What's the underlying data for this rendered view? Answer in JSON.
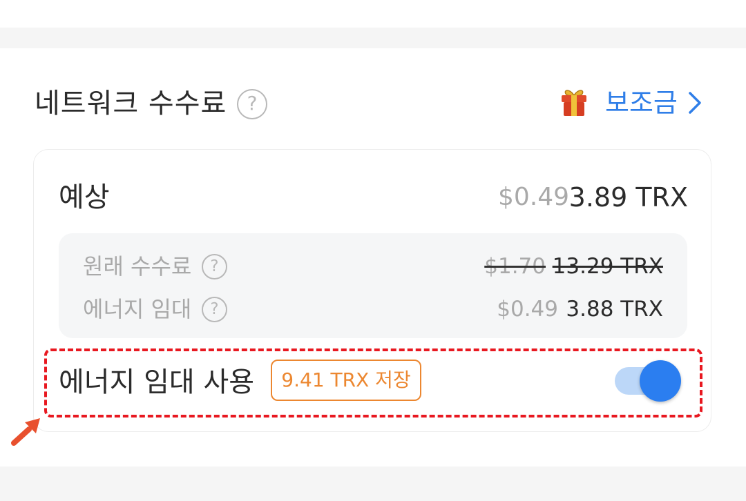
{
  "header": {
    "title": "네트워크 수수료",
    "help_glyph": "?",
    "subsidy_label": "보조금",
    "icons": [
      "help-icon",
      "gift-icon",
      "chevron-right-icon"
    ]
  },
  "estimate": {
    "label": "예상",
    "usd": "$0.49",
    "trx": "3.89 TRX"
  },
  "details": {
    "original_fee": {
      "label": "원래 수수료",
      "usd": "$1.70",
      "trx": "13.29 TRX",
      "strikethrough": true
    },
    "energy_rental": {
      "label": "에너지 임대",
      "usd": "$0.49",
      "trx": "3.88 TRX"
    }
  },
  "energy_toggle": {
    "label": "에너지 임대 사용",
    "badge": "9.41 TRX 저장",
    "enabled": true
  },
  "colors": {
    "accent": "#2f7ee8",
    "toggle_on": "#2b7ef0",
    "badge": "#ec8730",
    "highlight": "#e81820"
  }
}
